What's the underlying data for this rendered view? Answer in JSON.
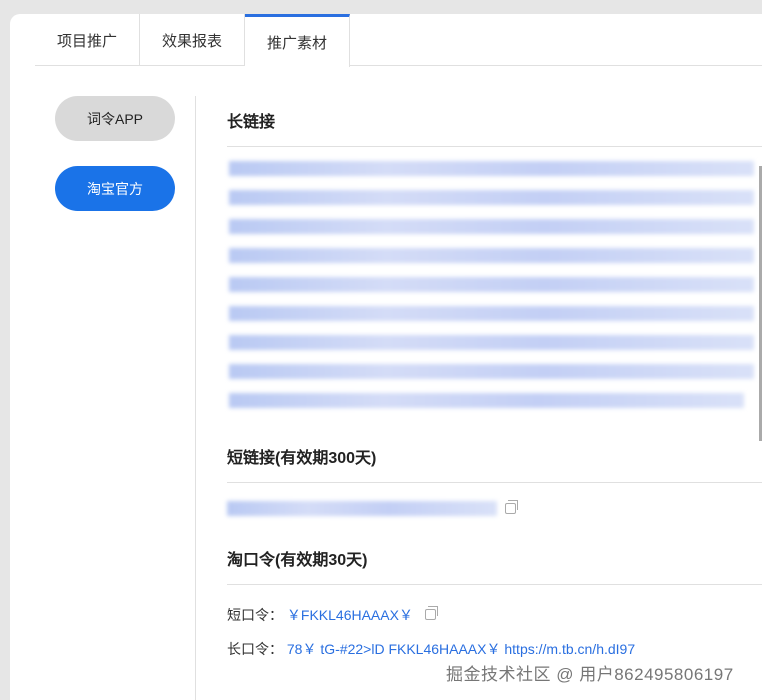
{
  "tabs": [
    {
      "label": "项目推广"
    },
    {
      "label": "效果报表"
    },
    {
      "label": "推广素材",
      "active": true
    }
  ],
  "sidebar": {
    "items": [
      {
        "label": "词令APP"
      },
      {
        "label": "淘宝官方",
        "active": true
      }
    ]
  },
  "main": {
    "long_link": {
      "title": "长链接"
    },
    "short_link": {
      "title": "短链接(有效期300天)"
    },
    "taokouling": {
      "title": "淘口令(有效期30天)",
      "short_label": "短口令：",
      "short_value": "￥FKKL46HAAAX￥",
      "long_label": "长口令：",
      "long_value": "78￥ tG-#22>lD FKKL46HAAAX￥ https://m.tb.cn/h.dI97"
    }
  },
  "watermark": "掘金技术社区 @ 用户862495806197",
  "colors": {
    "accent": "#1a73e8"
  }
}
